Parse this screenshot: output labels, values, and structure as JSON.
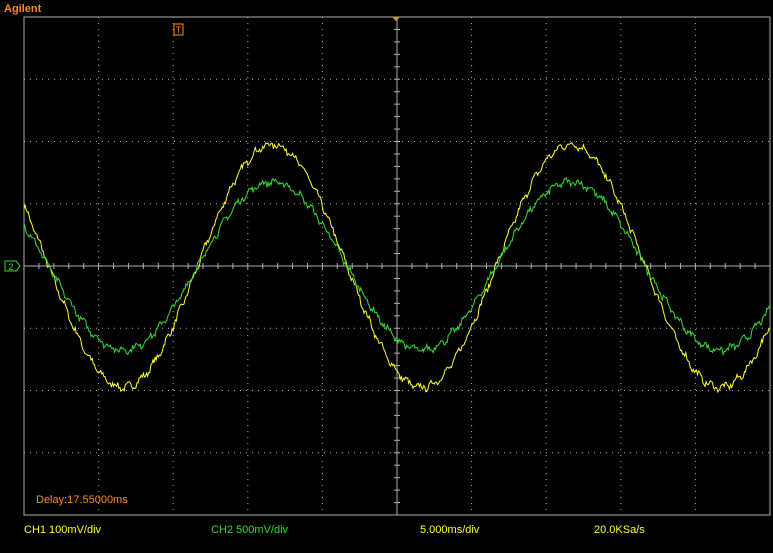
{
  "brand": "Agilent",
  "status_bar": {
    "delay": "Delay:17.55000ms",
    "ch1_scale": "CH1 100mV/div",
    "ch2_scale": "CH2 500mV/div",
    "time_scale": "5.000ms/div",
    "sample_rate": "20.0KSa/s"
  },
  "markers": {
    "trigger_label": "T",
    "ground_label": "2"
  },
  "colors": {
    "ch1": "#ffff33",
    "ch2": "#33dd33",
    "grid": "#b0b0b0",
    "accent": "#ff8c1a",
    "background": "#000000"
  },
  "chart_data": {
    "type": "line",
    "grid": true,
    "divisions": {
      "x": 10,
      "y": 8
    },
    "xlim": [
      0,
      10
    ],
    "ylim": [
      -4,
      4
    ],
    "xlabel_unit": "div",
    "series": [
      {
        "channel": "CH1",
        "color": "#ffff33",
        "amplitude_div": 1.95,
        "offset_div": 0.0,
        "period_div": 4.0,
        "peak_x_div": 3.33
      },
      {
        "channel": "CH2",
        "color": "#33dd33",
        "amplitude_div": 1.35,
        "offset_div": 0.0,
        "period_div": 4.0,
        "peak_x_div": 3.33
      }
    ]
  }
}
